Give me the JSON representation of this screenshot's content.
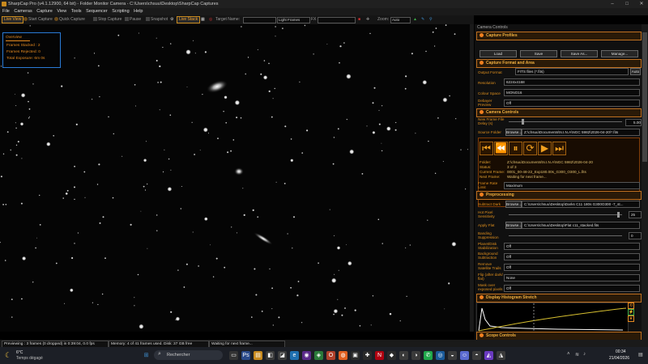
{
  "titlebar": {
    "title": "SharpCap Pro (v4.1.12900, 64 bit) - Folder Monitor Camera - C:\\Users\\chsuu\\Desktop\\SharpCap Captures"
  },
  "menu": [
    "File",
    "Cameras",
    "Capture",
    "View",
    "Tools",
    "Sequencer",
    "Scripting",
    "Help"
  ],
  "toolbar": {
    "live_view": "Live View",
    "start_capture": "Start Capture",
    "quick_capture": "Quick Capture",
    "stop_capture": "Stop Capture",
    "pause": "Pause",
    "snapshot": "Snapshot",
    "live_stack": "Live Stack",
    "target_name_label": "Target Name:",
    "target_name_value": "",
    "light_frames": "Light Frames",
    "fx_label": "FX",
    "fx_value": "",
    "zoom_label": "Zoom:",
    "zoom_value": "Auto"
  },
  "overview": {
    "title": "Overview",
    "frames_stacked": "Frames Stacked : 2",
    "frames_rejected": "Frames Rejected: 0",
    "total_exposure": "Total Exposure:    6m 0s"
  },
  "panel": {
    "title": "Camera Controls",
    "capture_profiles": {
      "header": "Capture Profiles",
      "load": "Load",
      "save": "Save",
      "save_as": "Save As...",
      "manage": "Manage..."
    },
    "capture_format": {
      "header": "Capture Format and Area",
      "output_format_label": "Output Format",
      "output_format_value": "FITS files (*.fits)",
      "auto": "Auto",
      "resolution_label": "Resolution",
      "resolution_value": "6224x4168",
      "colour_space_label": "Colour Space",
      "colour_space_value": "MONO16",
      "debayer_label": "Debayer Preview",
      "debayer_value": "Off"
    },
    "camera_controls": {
      "header": "Camera Controls",
      "new_frame_delay_label": "New Frame File Delay (s)",
      "new_frame_delay_value": "5.00",
      "source_folder_label": "Source Folder",
      "browse": "Browse...",
      "source_folder_value": "Z:\\chsuu\\Documents\\N.I.N.A\\NGC 5982\\2026-04-20\\*.fits",
      "folder_label": "Folder:",
      "folder_value": "Z:\\chsuu\\Documents\\N.I.N.A\\NGC 5982\\2026-04-20",
      "status_label": "Status:",
      "status_value": "3 of 3",
      "current_frame_label": "Current Frame:",
      "current_frame_value": "0001_00-48-22_Exp180.00s_G300_O300_L.fits",
      "next_frame_label": "Next Frame:",
      "next_frame_value": "Waiting for next frame...",
      "frame_rate_label": "Frame Rate Limit",
      "frame_rate_value": "Maximum"
    },
    "preprocessing": {
      "header": "Preprocessing",
      "subtract_dark_label": "Subtract Dark",
      "browse": "Browse...",
      "subtract_dark_value": "C:\\Users\\chsuu\\Desktop\\Darks C11 180s G300O300 -7_st...",
      "hot_pixel_label": "Hot Pixel Sensitivity",
      "hot_pixel_value": "25",
      "apply_flat_label": "Apply Flat",
      "apply_flat_value": "C:\\Users\\chsuu\\Desktop\\Flat c11_stacked.fits",
      "banding_label": "Banding Suppression",
      "banding_value": "0",
      "planet_label": "Planet/Disk Stabilization",
      "planet_value": "Off",
      "background_label": "Background Subtraction",
      "background_value": "Off",
      "satellite_label": "Remove Satellite Trails",
      "satellite_value": "Off",
      "flip_label": "Flip (after dark/ flat)",
      "flip_value": "None",
      "mask_label": "Mask over exposed pixels",
      "mask_value": "Off"
    },
    "histogram": {
      "header": "Display Histogram Stretch"
    },
    "scope": {
      "header": "Scope Controls"
    }
  },
  "status": {
    "preview": "Previewing : 3 frames (0 dropped) in 0:39:04, 0.0 fps",
    "memory": "Memory: 4 of 41 frames used. Disk: 37 GB free",
    "waiting": "Waiting for next frame..."
  },
  "taskbar": {
    "temp": "6°C",
    "weather": "Temps dégagé",
    "search": "Rechercher",
    "time": "00:34",
    "date": "21/04/2026"
  },
  "colors": {
    "accent": "#e58a20",
    "overview_border": "#2a7bd6",
    "panel_bg": "#101010"
  }
}
